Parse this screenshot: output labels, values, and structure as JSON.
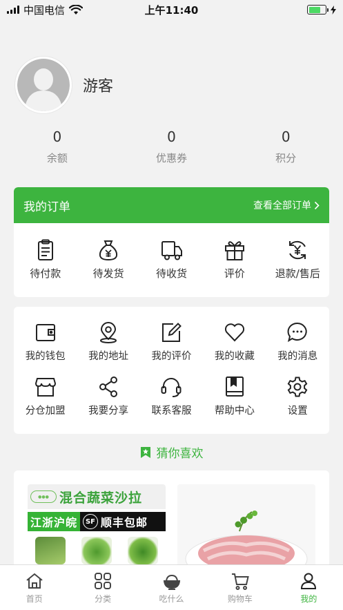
{
  "status_bar": {
    "carrier": "中国电信",
    "time": "上午11:40"
  },
  "profile": {
    "username": "游客"
  },
  "stats": [
    {
      "value": "0",
      "label": "余额"
    },
    {
      "value": "0",
      "label": "优惠券"
    },
    {
      "value": "0",
      "label": "积分"
    }
  ],
  "orders": {
    "title": "我的订单",
    "view_all": "查看全部订单",
    "items": [
      {
        "label": "待付款",
        "icon": "clipboard-icon"
      },
      {
        "label": "待发货",
        "icon": "money-bag-icon"
      },
      {
        "label": "待收货",
        "icon": "truck-icon"
      },
      {
        "label": "评价",
        "icon": "gift-icon"
      },
      {
        "label": "退款/售后",
        "icon": "refund-icon"
      }
    ]
  },
  "tools": [
    {
      "label": "我的钱包",
      "icon": "wallet-icon"
    },
    {
      "label": "我的地址",
      "icon": "location-icon"
    },
    {
      "label": "我的评价",
      "icon": "edit-icon"
    },
    {
      "label": "我的收藏",
      "icon": "heart-icon"
    },
    {
      "label": "我的消息",
      "icon": "chat-icon"
    },
    {
      "label": "分仓加盟",
      "icon": "store-icon"
    },
    {
      "label": "我要分享",
      "icon": "share-icon"
    },
    {
      "label": "联系客服",
      "icon": "headset-icon"
    },
    {
      "label": "帮助中心",
      "icon": "book-icon"
    },
    {
      "label": "设置",
      "icon": "gear-icon"
    }
  ],
  "guess_title": "猜你喜欢",
  "products": [
    {
      "title": "混合蔬菜沙拉",
      "band_left": "江浙沪皖",
      "band_sf": "SF",
      "band_right": "顺丰包邮"
    },
    {
      "title": ""
    }
  ],
  "tabbar": [
    {
      "label": "首页",
      "icon": "home-icon",
      "active": false
    },
    {
      "label": "分类",
      "icon": "category-icon",
      "active": false
    },
    {
      "label": "吃什么",
      "icon": "bowl-icon",
      "active": false
    },
    {
      "label": "购物车",
      "icon": "cart-icon",
      "active": false
    },
    {
      "label": "我的",
      "icon": "user-icon",
      "active": true
    }
  ],
  "colors": {
    "primary": "#3db43f",
    "background": "#f2f2f2",
    "tab_inactive": "#999999"
  }
}
